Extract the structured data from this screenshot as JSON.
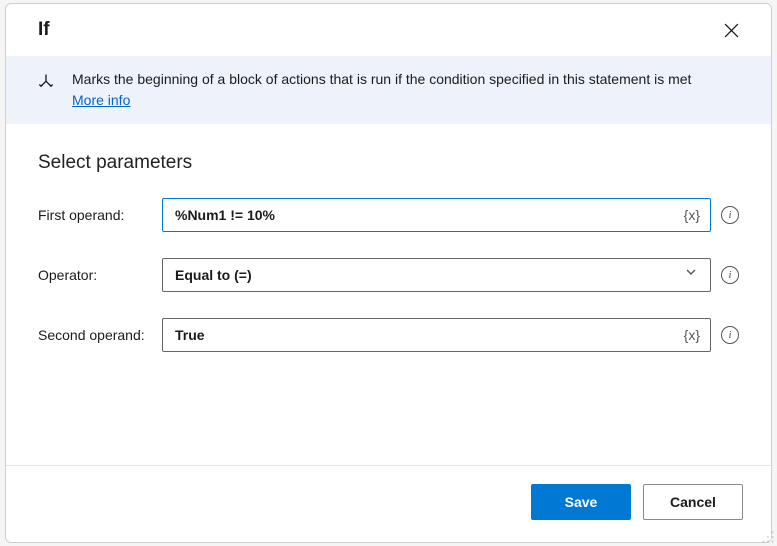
{
  "dialog": {
    "title": "If",
    "banner": {
      "text": "Marks the beginning of a block of actions that is run if the condition specified in this statement is met",
      "link_label": "More info"
    }
  },
  "section": {
    "heading": "Select parameters",
    "fields": {
      "first_operand": {
        "label": "First operand:",
        "value": "%Num1 != 10%",
        "var_token": "{x}"
      },
      "operator": {
        "label": "Operator:",
        "value": "Equal to (=)"
      },
      "second_operand": {
        "label": "Second operand:",
        "value": "True",
        "var_token": "{x}"
      }
    }
  },
  "footer": {
    "save_label": "Save",
    "cancel_label": "Cancel"
  }
}
